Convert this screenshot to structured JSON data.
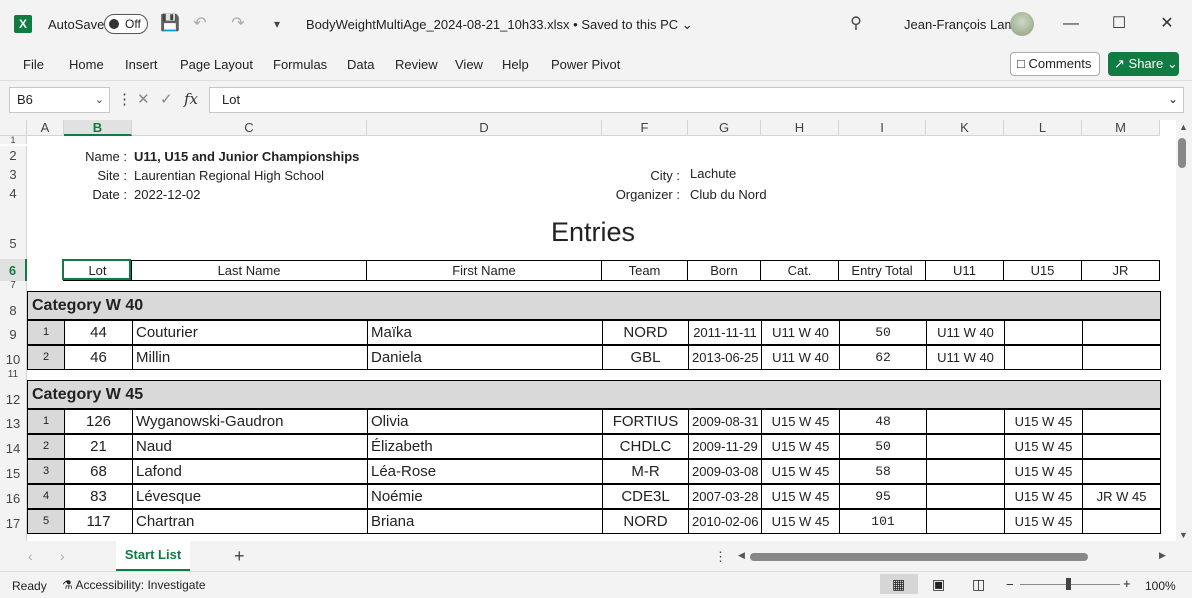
{
  "app": {
    "autosave_label": "AutoSave",
    "autosave_state": "Off",
    "file_title": "BodyWeightMultiAge_2024-08-21_10h33.xlsx  •  Saved to this PC",
    "user_name": "Jean-François Lamy",
    "accent": "#107c41"
  },
  "menu": [
    "File",
    "Home",
    "Insert",
    "Page Layout",
    "Formulas",
    "Data",
    "Review",
    "View",
    "Help",
    "Power Pivot"
  ],
  "buttons": {
    "comments": "Comments",
    "share": "Share"
  },
  "formula_bar": {
    "name_box": "B6",
    "content": "Lot",
    "fx": "fx"
  },
  "columns": [
    "A",
    "B",
    "C",
    "D",
    "F",
    "G",
    "H",
    "I",
    "K",
    "L",
    "M"
  ],
  "rows": [
    "1",
    "2",
    "3",
    "4",
    "5",
    "6",
    "7",
    "8",
    "9",
    "10",
    "11",
    "12",
    "13",
    "14",
    "15",
    "16",
    "17"
  ],
  "meta": {
    "name_label": "Name :",
    "name_value": "U11, U15 and Junior Championships",
    "site_label": "Site :",
    "site_value": "Laurentian Regional High School",
    "date_label": "Date :",
    "date_value": "2022-12-02",
    "city_label": "City :",
    "city_value": "Lachute",
    "organizer_label": "Organizer :",
    "organizer_value": "Club du Nord"
  },
  "sheet_title": "Entries",
  "table_headers": [
    "Lot",
    "Last Name",
    "First Name",
    "Team",
    "Born",
    "Cat.",
    "Entry Total",
    "U11",
    "U15",
    "JR"
  ],
  "categories": [
    {
      "label": "Category W 40",
      "rows": [
        {
          "n": "1",
          "lot": "44",
          "last": "Couturier",
          "first": "Maïka",
          "team": "NORD",
          "born": "2011-11-11",
          "cat": "U11 W 40",
          "total": "50",
          "u11": "U11 W 40",
          "u15": "",
          "jr": ""
        },
        {
          "n": "2",
          "lot": "46",
          "last": "Millin",
          "first": "Daniela",
          "team": "GBL",
          "born": "2013-06-25",
          "cat": "U11 W 40",
          "total": "62",
          "u11": "U11 W 40",
          "u15": "",
          "jr": ""
        }
      ]
    },
    {
      "label": "Category W 45",
      "rows": [
        {
          "n": "1",
          "lot": "126",
          "last": "Wyganowski-Gaudron",
          "first": "Olivia",
          "team": "FORTIUS",
          "born": "2009-08-31",
          "cat": "U15 W 45",
          "total": "48",
          "u11": "",
          "u15": "U15 W 45",
          "jr": ""
        },
        {
          "n": "2",
          "lot": "21",
          "last": "Naud",
          "first": "Élizabeth",
          "team": "CHDLC",
          "born": "2009-11-29",
          "cat": "U15 W 45",
          "total": "50",
          "u11": "",
          "u15": "U15 W 45",
          "jr": ""
        },
        {
          "n": "3",
          "lot": "68",
          "last": "Lafond",
          "first": "Léa-Rose",
          "team": "M-R",
          "born": "2009-03-08",
          "cat": "U15 W 45",
          "total": "58",
          "u11": "",
          "u15": "U15 W 45",
          "jr": ""
        },
        {
          "n": "4",
          "lot": "83",
          "last": "Lévesque",
          "first": "Noémie",
          "team": "CDE3L",
          "born": "2007-03-28",
          "cat": "U15 W 45",
          "total": "95",
          "u11": "",
          "u15": "U15 W 45",
          "jr": "JR W 45"
        },
        {
          "n": "5",
          "lot": "117",
          "last": "Chartran",
          "first": "Briana",
          "team": "NORD",
          "born": "2010-02-06",
          "cat": "U15 W 45",
          "total": "101",
          "u11": "",
          "u15": "U15 W 45",
          "jr": ""
        }
      ]
    }
  ],
  "sheet_tab": "Start List",
  "status": {
    "ready": "Ready",
    "accessibility": "Accessibility: Investigate",
    "zoom": "100%"
  }
}
